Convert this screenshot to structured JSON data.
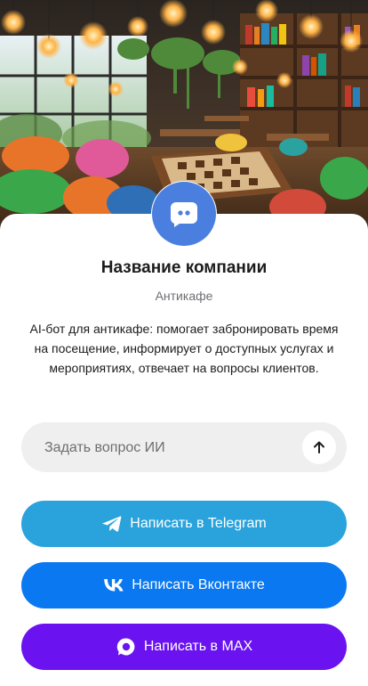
{
  "hero": {
    "image_icon": "anticafe-interior-image"
  },
  "company": {
    "avatar_icon": "chat-bot-icon",
    "name": "Название компании",
    "category": "Антикафе",
    "description": "AI-бот для антикафе: помогает забронировать время на посещение, информирует о доступных услугах и мероприятиях, отвечает на вопросы клиентов."
  },
  "ask": {
    "placeholder": "Задать вопрос ИИ",
    "value": "",
    "send_icon": "arrow-up-icon"
  },
  "buttons": [
    {
      "id": "telegram",
      "label": "Написать в Telegram",
      "icon": "telegram-icon",
      "color": "#2aa3dc"
    },
    {
      "id": "vk",
      "label": "Написать Вконтакте",
      "icon": "vk-icon",
      "color": "#0a78f0"
    },
    {
      "id": "max",
      "label": "Написать в MAX",
      "icon": "max-icon",
      "color": "#6a13f0"
    }
  ],
  "colors": {
    "avatar_bg": "#4a7fe0",
    "ask_bg": "#efefef",
    "text_primary": "#1c1c1e",
    "text_secondary": "#6e6e73"
  }
}
